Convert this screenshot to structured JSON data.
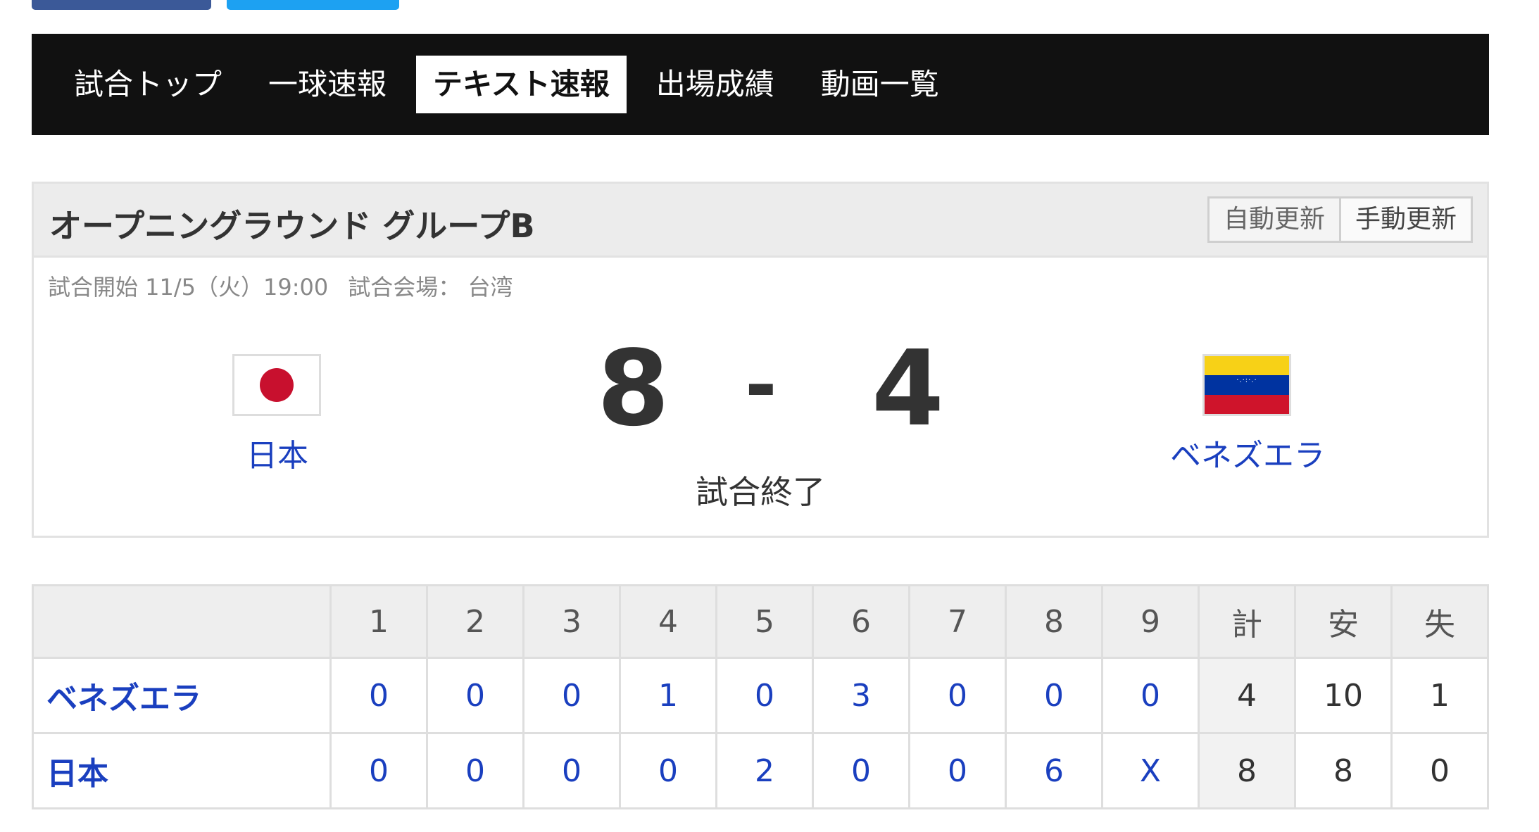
{
  "tabs": [
    {
      "label": "試合トップ"
    },
    {
      "label": "一球速報"
    },
    {
      "label": "テキスト速報",
      "active": true
    },
    {
      "label": "出場成績"
    },
    {
      "label": "動画一覧"
    }
  ],
  "game": {
    "title": "オープニングラウンド グループB",
    "auto_update": "自動更新",
    "manual_update": "手動更新",
    "start": "試合開始 11/5（火）19:00",
    "venue": "試合会場： 台湾",
    "home_team": "日本",
    "away_team": "ベネズエラ",
    "home_score": "8",
    "dash": "-",
    "away_score": "4",
    "status": "試合終了"
  },
  "linescore": {
    "headers": [
      "",
      "1",
      "2",
      "3",
      "4",
      "5",
      "6",
      "7",
      "8",
      "9",
      "計",
      "安",
      "失"
    ],
    "rows": [
      {
        "team": "ベネズエラ",
        "innings": [
          "0",
          "0",
          "0",
          "1",
          "0",
          "3",
          "0",
          "0",
          "0"
        ],
        "total": "4",
        "hits": "10",
        "errors": "1"
      },
      {
        "team": "日本",
        "innings": [
          "0",
          "0",
          "0",
          "0",
          "2",
          "0",
          "0",
          "6",
          "X"
        ],
        "total": "8",
        "hits": "8",
        "errors": "0"
      }
    ]
  }
}
